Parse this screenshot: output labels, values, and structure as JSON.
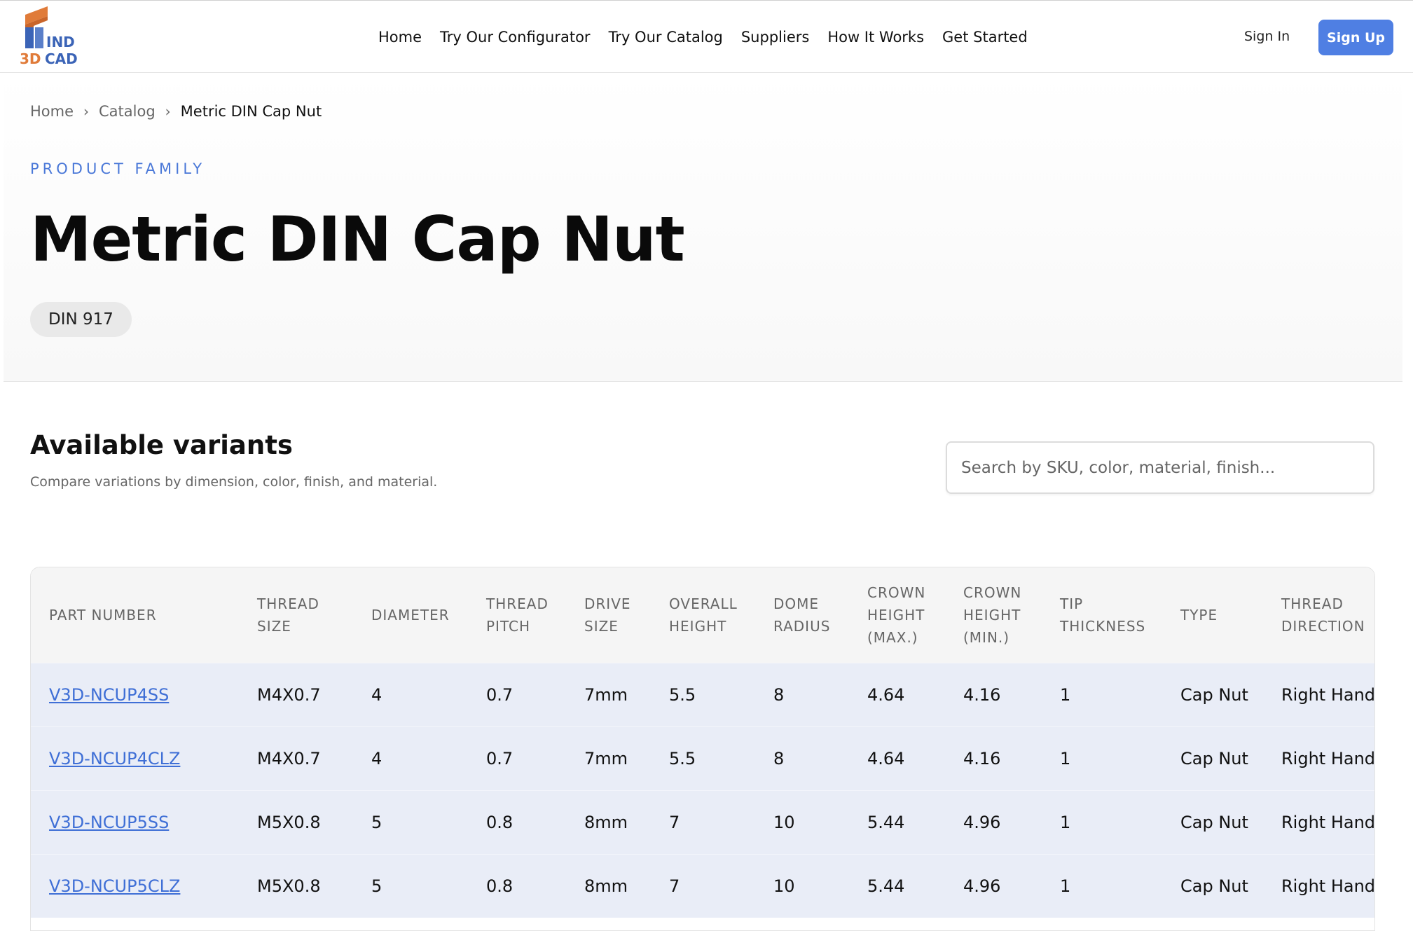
{
  "logo": {
    "line1": "IND",
    "line2": "3DCAD"
  },
  "nav": [
    "Home",
    "Try Our Configurator",
    "Try Our Catalog",
    "Suppliers",
    "How It Works",
    "Get Started"
  ],
  "auth": {
    "sign_in": "Sign In",
    "sign_up": "Sign Up"
  },
  "breadcrumb": {
    "items": [
      "Home",
      "Catalog"
    ],
    "current": "Metric DIN Cap Nut"
  },
  "hero": {
    "eyebrow": "PRODUCT FAMILY",
    "title": "Metric DIN Cap Nut",
    "badge": "DIN 917"
  },
  "variants": {
    "title": "Available variants",
    "subtitle": "Compare variations by dimension, color, finish, and material.",
    "search_placeholder": "Search by SKU, color, material, finish..."
  },
  "table": {
    "columns": [
      "PART NUMBER",
      "THREAD SIZE",
      "DIAMETER",
      "THREAD PITCH",
      "DRIVE SIZE",
      "OVERALL HEIGHT",
      "DOME RADIUS",
      "CROWN HEIGHT (MAX.)",
      "CROWN HEIGHT (MIN.)",
      "TIP THICKNESS",
      "TYPE",
      "THREAD DIRECTION"
    ],
    "rows": [
      [
        "V3D-NCUP4SS",
        "M4X0.7",
        "4",
        "0.7",
        "7mm",
        "5.5",
        "8",
        "4.64",
        "4.16",
        "1",
        "Cap Nut",
        "Right Hand"
      ],
      [
        "V3D-NCUP4CLZ",
        "M4X0.7",
        "4",
        "0.7",
        "7mm",
        "5.5",
        "8",
        "4.64",
        "4.16",
        "1",
        "Cap Nut",
        "Right Hand"
      ],
      [
        "V3D-NCUP5SS",
        "M5X0.8",
        "5",
        "0.8",
        "8mm",
        "7",
        "10",
        "5.44",
        "4.96",
        "1",
        "Cap Nut",
        "Right Hand"
      ],
      [
        "V3D-NCUP5CLZ",
        "M5X0.8",
        "5",
        "0.8",
        "8mm",
        "7",
        "10",
        "5.44",
        "4.96",
        "1",
        "Cap Nut",
        "Right Hand"
      ]
    ]
  },
  "colors": {
    "accent": "#4f7fe3",
    "link": "#3f6fd6",
    "row_bg": "#e9edf7",
    "logo_orange": "#e07b39",
    "logo_blue": "#3b64b7"
  }
}
